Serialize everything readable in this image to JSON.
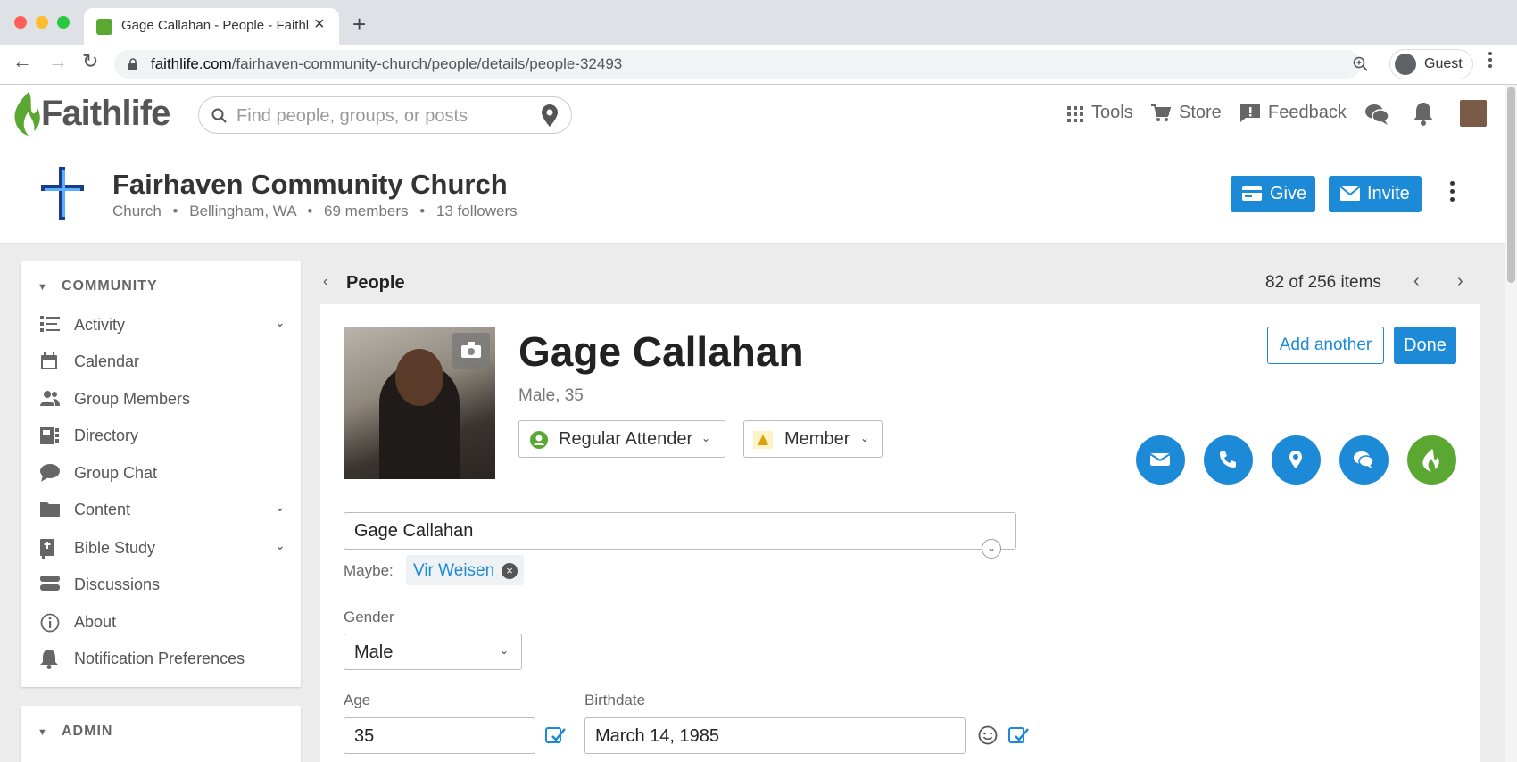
{
  "browser": {
    "tab_title": "Gage Callahan - People - Faithl",
    "url_host": "faithlife.com",
    "url_path": "/fairhaven-community-church/people/details/people-32493",
    "profile_name": "Guest",
    "colors": {
      "close": "#ff5f57",
      "minimize": "#febc2e",
      "maximize": "#28c840"
    }
  },
  "header": {
    "logo": "Faithlife",
    "search_placeholder": "Find people, groups, or posts",
    "tools": "Tools",
    "store": "Store",
    "feedback": "Feedback"
  },
  "church": {
    "name": "Fairhaven Community Church",
    "type": "Church",
    "location": "Bellingham, WA",
    "members": "69 members",
    "followers": "13 followers",
    "give_label": "Give",
    "invite_label": "Invite"
  },
  "sidebar": {
    "community_label": "COMMUNITY",
    "admin_label": "ADMIN",
    "items": [
      {
        "label": "Activity",
        "icon": "activity-icon",
        "expandable": true
      },
      {
        "label": "Calendar",
        "icon": "calendar-icon",
        "expandable": false
      },
      {
        "label": "Group Members",
        "icon": "members-icon",
        "expandable": false
      },
      {
        "label": "Directory",
        "icon": "directory-icon",
        "expandable": false
      },
      {
        "label": "Group Chat",
        "icon": "chat-icon",
        "expandable": false
      },
      {
        "label": "Content",
        "icon": "folder-icon",
        "expandable": true
      },
      {
        "label": "Bible Study",
        "icon": "bible-icon",
        "expandable": true
      },
      {
        "label": "Discussions",
        "icon": "discussions-icon",
        "expandable": false
      },
      {
        "label": "About",
        "icon": "info-icon",
        "expandable": false
      },
      {
        "label": "Notification Preferences",
        "icon": "bell-icon",
        "expandable": false
      }
    ]
  },
  "main": {
    "section_title": "People",
    "items_count": "82 of 256 items",
    "person": {
      "name": "Gage Callahan",
      "sub": "Male, 35",
      "status": "Regular Attender",
      "membership": "Member",
      "name_field": "Gage Callahan",
      "maybe_label": "Maybe:",
      "maybe_name": "Vir Weisen",
      "gender_label": "Gender",
      "gender_value": "Male",
      "age_label": "Age",
      "age_value": "35",
      "birthdate_label": "Birthdate",
      "birthdate_value": "March 14, 1985"
    },
    "add_another_label": "Add another",
    "done_label": "Done"
  },
  "colors": {
    "primary": "#1d8ad8",
    "faithlife_green": "#5aa832"
  }
}
